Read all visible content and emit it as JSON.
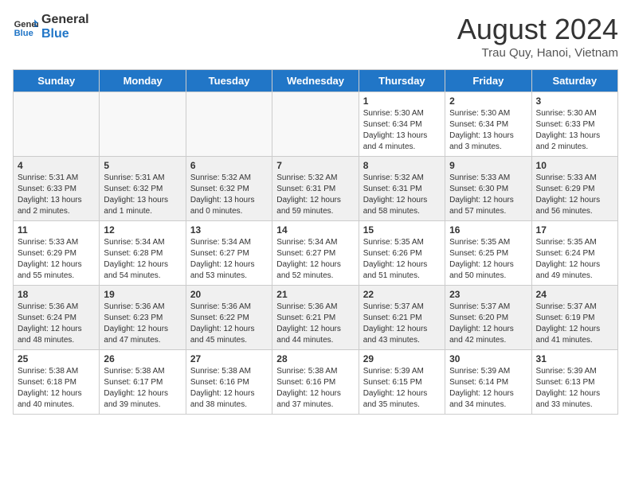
{
  "logo": {
    "line1": "General",
    "line2": "Blue"
  },
  "title": "August 2024",
  "subtitle": "Trau Quy, Hanoi, Vietnam",
  "weekdays": [
    "Sunday",
    "Monday",
    "Tuesday",
    "Wednesday",
    "Thursday",
    "Friday",
    "Saturday"
  ],
  "weeks": [
    [
      {
        "day": "",
        "info": ""
      },
      {
        "day": "",
        "info": ""
      },
      {
        "day": "",
        "info": ""
      },
      {
        "day": "",
        "info": ""
      },
      {
        "day": "1",
        "info": "Sunrise: 5:30 AM\nSunset: 6:34 PM\nDaylight: 13 hours\nand 4 minutes."
      },
      {
        "day": "2",
        "info": "Sunrise: 5:30 AM\nSunset: 6:34 PM\nDaylight: 13 hours\nand 3 minutes."
      },
      {
        "day": "3",
        "info": "Sunrise: 5:30 AM\nSunset: 6:33 PM\nDaylight: 13 hours\nand 2 minutes."
      }
    ],
    [
      {
        "day": "4",
        "info": "Sunrise: 5:31 AM\nSunset: 6:33 PM\nDaylight: 13 hours\nand 2 minutes."
      },
      {
        "day": "5",
        "info": "Sunrise: 5:31 AM\nSunset: 6:32 PM\nDaylight: 13 hours\nand 1 minute."
      },
      {
        "day": "6",
        "info": "Sunrise: 5:32 AM\nSunset: 6:32 PM\nDaylight: 13 hours\nand 0 minutes."
      },
      {
        "day": "7",
        "info": "Sunrise: 5:32 AM\nSunset: 6:31 PM\nDaylight: 12 hours\nand 59 minutes."
      },
      {
        "day": "8",
        "info": "Sunrise: 5:32 AM\nSunset: 6:31 PM\nDaylight: 12 hours\nand 58 minutes."
      },
      {
        "day": "9",
        "info": "Sunrise: 5:33 AM\nSunset: 6:30 PM\nDaylight: 12 hours\nand 57 minutes."
      },
      {
        "day": "10",
        "info": "Sunrise: 5:33 AM\nSunset: 6:29 PM\nDaylight: 12 hours\nand 56 minutes."
      }
    ],
    [
      {
        "day": "11",
        "info": "Sunrise: 5:33 AM\nSunset: 6:29 PM\nDaylight: 12 hours\nand 55 minutes."
      },
      {
        "day": "12",
        "info": "Sunrise: 5:34 AM\nSunset: 6:28 PM\nDaylight: 12 hours\nand 54 minutes."
      },
      {
        "day": "13",
        "info": "Sunrise: 5:34 AM\nSunset: 6:27 PM\nDaylight: 12 hours\nand 53 minutes."
      },
      {
        "day": "14",
        "info": "Sunrise: 5:34 AM\nSunset: 6:27 PM\nDaylight: 12 hours\nand 52 minutes."
      },
      {
        "day": "15",
        "info": "Sunrise: 5:35 AM\nSunset: 6:26 PM\nDaylight: 12 hours\nand 51 minutes."
      },
      {
        "day": "16",
        "info": "Sunrise: 5:35 AM\nSunset: 6:25 PM\nDaylight: 12 hours\nand 50 minutes."
      },
      {
        "day": "17",
        "info": "Sunrise: 5:35 AM\nSunset: 6:24 PM\nDaylight: 12 hours\nand 49 minutes."
      }
    ],
    [
      {
        "day": "18",
        "info": "Sunrise: 5:36 AM\nSunset: 6:24 PM\nDaylight: 12 hours\nand 48 minutes."
      },
      {
        "day": "19",
        "info": "Sunrise: 5:36 AM\nSunset: 6:23 PM\nDaylight: 12 hours\nand 47 minutes."
      },
      {
        "day": "20",
        "info": "Sunrise: 5:36 AM\nSunset: 6:22 PM\nDaylight: 12 hours\nand 45 minutes."
      },
      {
        "day": "21",
        "info": "Sunrise: 5:36 AM\nSunset: 6:21 PM\nDaylight: 12 hours\nand 44 minutes."
      },
      {
        "day": "22",
        "info": "Sunrise: 5:37 AM\nSunset: 6:21 PM\nDaylight: 12 hours\nand 43 minutes."
      },
      {
        "day": "23",
        "info": "Sunrise: 5:37 AM\nSunset: 6:20 PM\nDaylight: 12 hours\nand 42 minutes."
      },
      {
        "day": "24",
        "info": "Sunrise: 5:37 AM\nSunset: 6:19 PM\nDaylight: 12 hours\nand 41 minutes."
      }
    ],
    [
      {
        "day": "25",
        "info": "Sunrise: 5:38 AM\nSunset: 6:18 PM\nDaylight: 12 hours\nand 40 minutes."
      },
      {
        "day": "26",
        "info": "Sunrise: 5:38 AM\nSunset: 6:17 PM\nDaylight: 12 hours\nand 39 minutes."
      },
      {
        "day": "27",
        "info": "Sunrise: 5:38 AM\nSunset: 6:16 PM\nDaylight: 12 hours\nand 38 minutes."
      },
      {
        "day": "28",
        "info": "Sunrise: 5:38 AM\nSunset: 6:16 PM\nDaylight: 12 hours\nand 37 minutes."
      },
      {
        "day": "29",
        "info": "Sunrise: 5:39 AM\nSunset: 6:15 PM\nDaylight: 12 hours\nand 35 minutes."
      },
      {
        "day": "30",
        "info": "Sunrise: 5:39 AM\nSunset: 6:14 PM\nDaylight: 12 hours\nand 34 minutes."
      },
      {
        "day": "31",
        "info": "Sunrise: 5:39 AM\nSunset: 6:13 PM\nDaylight: 12 hours\nand 33 minutes."
      }
    ]
  ]
}
